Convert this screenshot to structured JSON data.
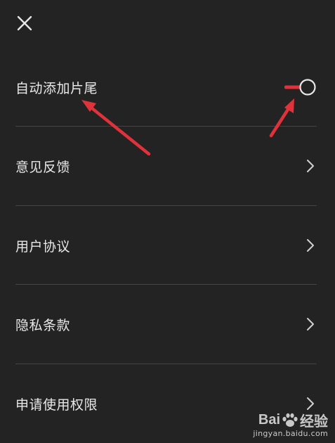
{
  "header": {
    "close_icon": "close-icon"
  },
  "settings": {
    "auto_outro": {
      "label": "自动添加片尾",
      "toggle_on": false
    },
    "feedback": {
      "label": "意见反馈"
    },
    "user_agreement": {
      "label": "用户协议"
    },
    "privacy": {
      "label": "隐私条款"
    },
    "permissions": {
      "label": "申请使用权限"
    }
  },
  "watermark": {
    "brand_left": "Bai",
    "brand_right": "经验",
    "url": "jingyan.baidu.com"
  },
  "colors": {
    "background": "#232323",
    "divider": "#444444",
    "annotation_arrow": "#e0323a",
    "toggle_accent": "#e0323a"
  }
}
